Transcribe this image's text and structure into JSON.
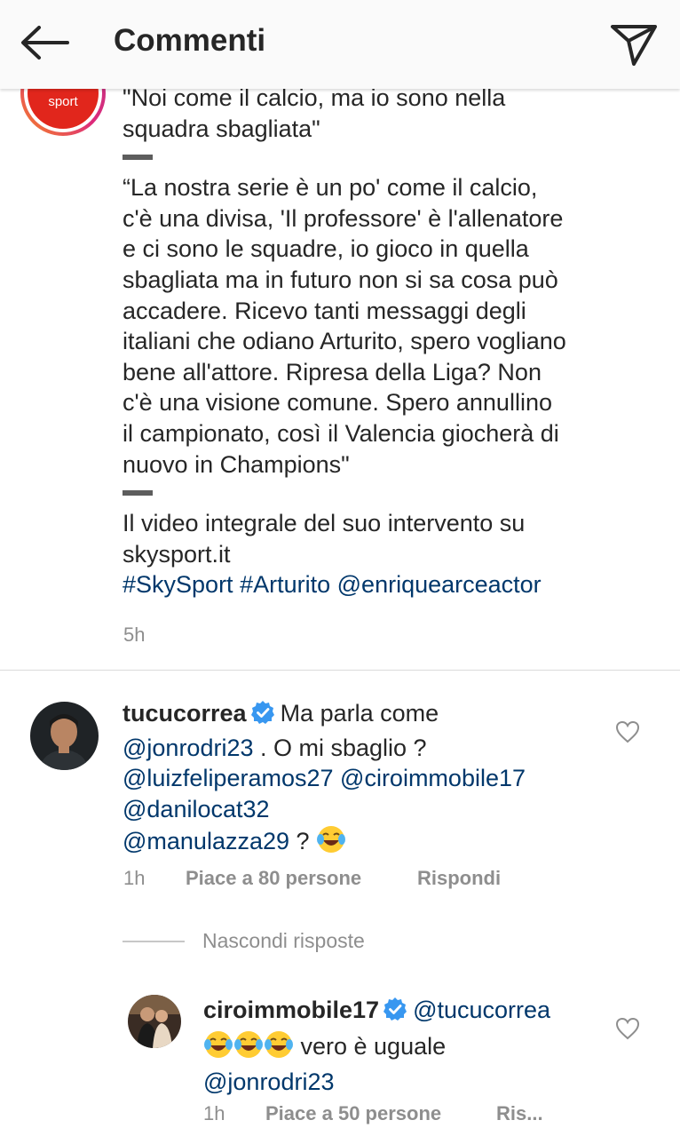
{
  "header": {
    "title": "Commenti",
    "back_icon": "arrow-left-icon",
    "send_icon": "paper-plane-icon"
  },
  "post_caption": {
    "avatar_label": "sport",
    "lines_quote1": [
      "\"Noi come il calcio, ma io sono nella",
      "squadra sbagliata\""
    ],
    "lines_quote2": [
      "“La nostra serie è un po' come il calcio,",
      "c'è una divisa, 'Il professore' è l'allenatore",
      "e ci sono le squadre, io gioco in quella",
      "sbagliata ma in futuro non si sa cosa può",
      "accadere. Ricevo tanti messaggi degli",
      "italiani che odiano Arturito, spero vogliano",
      "bene all'attore. Ripresa della Liga? Non",
      "c'è una visione comune. Spero annullino",
      "il campionato, così il Valencia giocherà di",
      "nuovo in Champions\""
    ],
    "lines_footer": [
      "Il video integrale del suo intervento su",
      "skysport.it"
    ],
    "hashtags": [
      "#SkySport",
      "#Arturito",
      "@enriquearceactor"
    ],
    "time": "5h"
  },
  "comment1": {
    "username": "tucucorrea",
    "text1": "Ma parla come",
    "mention1": "@jonrodri23",
    "text2": " . O mi sbaglio ?",
    "mention2": "@luizfeliperamos27",
    "mention3": "@ciroimmobile17",
    "mention4": "@danilocat32",
    "mention5": "@manulazza29",
    "text3": " ? ",
    "time": "1h",
    "likes": "Piace a 80 persone",
    "reply": "Rispondi"
  },
  "hide_replies": "Nascondi risposte",
  "reply1": {
    "username": "ciroimmobile17",
    "mention1": "@tucucorrea",
    "text1": " vero è uguale",
    "mention2": "@jonrodri23",
    "time": "1h",
    "likes": "Piace a 50 persone",
    "reply": "Ris..."
  },
  "colors": {
    "link": "#00376b",
    "meta": "#8e8e8e",
    "verified": "#3897f0",
    "sky_red": "#e1261c"
  }
}
